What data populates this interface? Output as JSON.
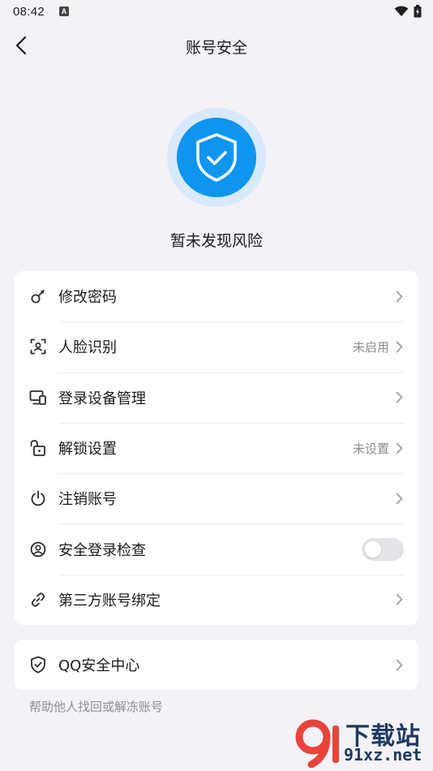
{
  "status_bar": {
    "time": "08:42",
    "notification": "A"
  },
  "header": {
    "title": "账号安全"
  },
  "hero": {
    "status_text": "暂未发现风险"
  },
  "security_items": [
    {
      "icon": "key-icon",
      "label": "修改密码",
      "value": ""
    },
    {
      "icon": "face-scan-icon",
      "label": "人脸识别",
      "value": "未启用"
    },
    {
      "icon": "devices-icon",
      "label": "登录设备管理",
      "value": ""
    },
    {
      "icon": "unlock-icon",
      "label": "解锁设置",
      "value": "未设置"
    },
    {
      "icon": "power-icon",
      "label": "注销账号",
      "value": ""
    },
    {
      "icon": "user-circle-icon",
      "label": "安全登录检查",
      "toggle_on": false
    },
    {
      "icon": "link-icon",
      "label": "第三方账号绑定",
      "value": ""
    }
  ],
  "qq_center": {
    "icon": "shield-check-icon",
    "label": "QQ安全中心"
  },
  "footer": {
    "link": "帮助他人找回或解冻账号"
  },
  "watermark": {
    "brand": "下载站",
    "domain": "91xz.net",
    "mark": "9"
  },
  "colors": {
    "accent": "#0e95f0",
    "accent_light": "#d7e9fb",
    "background": "#f2f2f7"
  }
}
